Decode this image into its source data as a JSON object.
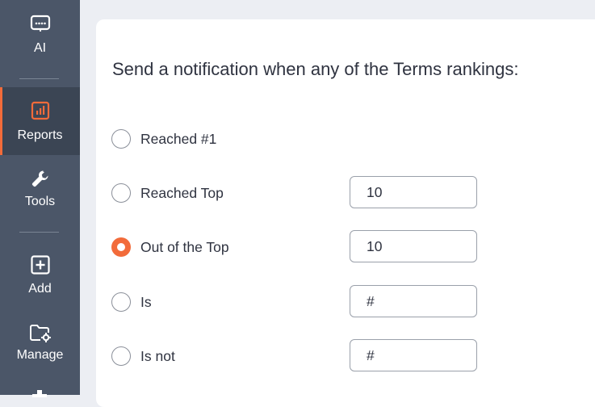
{
  "sidebar": {
    "items": [
      {
        "label": "AI",
        "icon": "ai-chip-icon"
      },
      {
        "label": "Reports",
        "icon": "reports-chart-icon",
        "active": true
      },
      {
        "label": "Tools",
        "icon": "wrench-icon"
      },
      {
        "label": "Add",
        "icon": "plus-square-icon"
      },
      {
        "label": "Manage",
        "icon": "folder-gear-icon"
      }
    ]
  },
  "main": {
    "heading": "Send a notification when any of the Terms rankings:",
    "options": [
      {
        "label": "Reached #1",
        "checked": false
      },
      {
        "label": "Reached Top",
        "checked": false,
        "value": "10"
      },
      {
        "label": "Out of the Top",
        "checked": true,
        "value": "10"
      },
      {
        "label": "Is",
        "checked": false,
        "placeholder": "#"
      },
      {
        "label": "Is not",
        "checked": false,
        "placeholder": "#"
      }
    ]
  },
  "colors": {
    "sidebar_bg": "#4b5668",
    "accent": "#f26b3a",
    "text": "#2f3340"
  }
}
